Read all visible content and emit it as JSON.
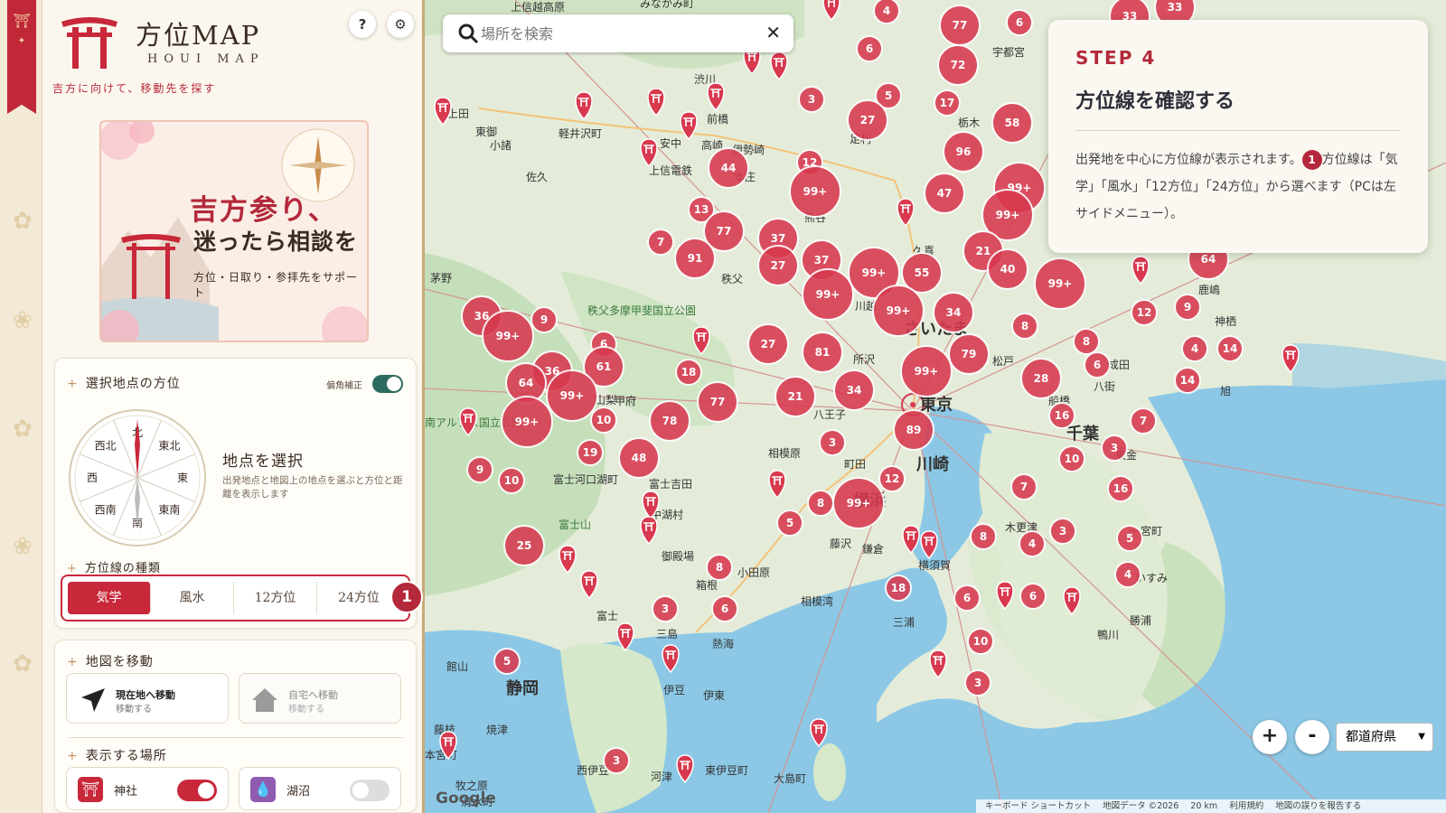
{
  "app": {
    "title": "方位MAP",
    "subtitle": "HOUI MAP",
    "tagline": "吉方に向けて、移動先を探す",
    "help_icon": "?",
    "settings_icon": "⚙"
  },
  "banner": {
    "line1": "吉方参り、",
    "line2": "迷ったら相談を",
    "line3": "方位・日取り・参拝先をサポート"
  },
  "direction_section": {
    "heading": "選択地点の方位",
    "toggle_label": "偏角補正",
    "toggle_on": true,
    "compass_labels": [
      "北",
      "東北",
      "東",
      "東南",
      "南",
      "西南",
      "西",
      "西北"
    ],
    "point_title": "地点を選択",
    "point_desc": "出発地点と地図上の地点を選ぶと方位と距離を表示します"
  },
  "line_types": {
    "heading": "方位線の種類",
    "options": [
      "気学",
      "風水",
      "12方位",
      "24方位"
    ],
    "selected": "気学",
    "step_badge": "1"
  },
  "move_section": {
    "heading": "地図を移動",
    "current": {
      "label": "現在地へ移動",
      "sub": "移動する"
    },
    "home": {
      "label": "自宅へ移動",
      "sub": "移動する"
    }
  },
  "places_section": {
    "heading": "表示する場所",
    "items": [
      {
        "label": "神社",
        "on": true,
        "icon": "torii-icon",
        "color": "#c8283a"
      },
      {
        "label": "湖沼",
        "on": false,
        "icon": "water-drop-icon",
        "color": "#8e5bb0"
      }
    ]
  },
  "search": {
    "placeholder": "場所を検索",
    "value": ""
  },
  "step_panel": {
    "step": "STEP 4",
    "title": "方位線を確認する",
    "body_before": "出発地を中心に方位線が表示されます。",
    "badge": "1",
    "body_after": "方位線は「気学」「風水」「12方位」「24方位」から選べます（PCは左サイドメニュー）。"
  },
  "map_controls": {
    "zoom_in": "+",
    "zoom_out": "-",
    "region_select": "都道府県"
  },
  "attribution": {
    "google": "Google",
    "shortcuts": "キーボード ショートカット",
    "data": "地図データ ©2026",
    "scale": "20 km",
    "terms": "利用規約",
    "report": "地図の誤りを報告する"
  },
  "map": {
    "places": [
      {
        "name": "上信越高原"
      },
      {
        "name": "みなかみ町"
      },
      {
        "name": "渋川"
      },
      {
        "name": "宇都宮"
      },
      {
        "name": "上田"
      },
      {
        "name": "軽井沢町"
      },
      {
        "name": "前橋"
      },
      {
        "name": "高崎"
      },
      {
        "name": "東御"
      },
      {
        "name": "小諸"
      },
      {
        "name": "安中"
      },
      {
        "name": "伊勢崎"
      },
      {
        "name": "足利"
      },
      {
        "name": "本庄"
      },
      {
        "name": "佐久"
      },
      {
        "name": "上信電鉄"
      },
      {
        "name": "栃木"
      },
      {
        "name": "熊谷"
      },
      {
        "name": "久喜"
      },
      {
        "name": "茅野"
      },
      {
        "name": "秩父"
      },
      {
        "name": "川越"
      },
      {
        "name": "さいたま"
      },
      {
        "name": "所沢"
      },
      {
        "name": "秩父多摩甲斐国立公園"
      },
      {
        "name": "甲府"
      },
      {
        "name": "山梨"
      },
      {
        "name": "八王子"
      },
      {
        "name": "東京"
      },
      {
        "name": "松戸"
      },
      {
        "name": "船橋"
      },
      {
        "name": "八街"
      },
      {
        "name": "成田"
      },
      {
        "name": "鹿嶋"
      },
      {
        "name": "神栖"
      },
      {
        "name": "旭"
      },
      {
        "name": "南アルプス国立公園"
      },
      {
        "name": "相模原"
      },
      {
        "name": "町田"
      },
      {
        "name": "川崎"
      },
      {
        "name": "千葉"
      },
      {
        "name": "東金"
      },
      {
        "name": "富士河口湖町"
      },
      {
        "name": "富士吉田"
      },
      {
        "name": "中湖村"
      },
      {
        "name": "富士山"
      },
      {
        "name": "横浜"
      },
      {
        "name": "木更津"
      },
      {
        "name": "藤沢"
      },
      {
        "name": "鎌倉"
      },
      {
        "name": "横須賀"
      },
      {
        "name": "小田原"
      },
      {
        "name": "御殿場"
      },
      {
        "name": "箱根"
      },
      {
        "name": "一宮町"
      },
      {
        "name": "いすみ"
      },
      {
        "name": "富士"
      },
      {
        "name": "三島"
      },
      {
        "name": "熱海"
      },
      {
        "name": "三浦"
      },
      {
        "name": "勝浦"
      },
      {
        "name": "鴨川"
      },
      {
        "name": "静岡"
      },
      {
        "name": "伊豆"
      },
      {
        "name": "伊東"
      },
      {
        "name": "相模湾"
      },
      {
        "name": "館山"
      },
      {
        "name": "焼津"
      },
      {
        "name": "藤枝"
      },
      {
        "name": "西伊豆"
      },
      {
        "name": "河津"
      },
      {
        "name": "東伊豆町"
      },
      {
        "name": "大島町"
      },
      {
        "name": "牧之原"
      },
      {
        "name": "本宮町"
      },
      {
        "name": "清水町"
      }
    ],
    "clusters": [
      {
        "label": "4"
      },
      {
        "label": "77"
      },
      {
        "label": "6"
      },
      {
        "label": "33"
      },
      {
        "label": "33"
      },
      {
        "label": "72"
      },
      {
        "label": "6"
      },
      {
        "label": "3"
      },
      {
        "label": "5"
      },
      {
        "label": "17"
      },
      {
        "label": "27"
      },
      {
        "label": "58"
      },
      {
        "label": "96"
      },
      {
        "label": "44"
      },
      {
        "label": "12"
      },
      {
        "label": "99+"
      },
      {
        "label": "99+"
      },
      {
        "label": "47"
      },
      {
        "label": "99+"
      },
      {
        "label": "13"
      },
      {
        "label": "77"
      },
      {
        "label": "7"
      },
      {
        "label": "91"
      },
      {
        "label": "37"
      },
      {
        "label": "27"
      },
      {
        "label": "37"
      },
      {
        "label": "99+"
      },
      {
        "label": "55"
      },
      {
        "label": "21"
      },
      {
        "label": "40"
      },
      {
        "label": "99+"
      },
      {
        "label": "64"
      },
      {
        "label": "99+"
      },
      {
        "label": "99+"
      },
      {
        "label": "34"
      },
      {
        "label": "12"
      },
      {
        "label": "9"
      },
      {
        "label": "36"
      },
      {
        "label": "99+"
      },
      {
        "label": "9"
      },
      {
        "label": "8"
      },
      {
        "label": "6"
      },
      {
        "label": "27"
      },
      {
        "label": "81"
      },
      {
        "label": "79"
      },
      {
        "label": "8"
      },
      {
        "label": "4"
      },
      {
        "label": "14"
      },
      {
        "label": "61"
      },
      {
        "label": "36"
      },
      {
        "label": "18"
      },
      {
        "label": "99+"
      },
      {
        "label": "6"
      },
      {
        "label": "64"
      },
      {
        "label": "99+"
      },
      {
        "label": "34"
      },
      {
        "label": "77"
      },
      {
        "label": "21"
      },
      {
        "label": "28"
      },
      {
        "label": "14"
      },
      {
        "label": "10"
      },
      {
        "label": "78"
      },
      {
        "label": "99+"
      },
      {
        "label": "89"
      },
      {
        "label": "16"
      },
      {
        "label": "7"
      },
      {
        "label": "19"
      },
      {
        "label": "48"
      },
      {
        "label": "3"
      },
      {
        "label": "3"
      },
      {
        "label": "9"
      },
      {
        "label": "10"
      },
      {
        "label": "12"
      },
      {
        "label": "10"
      },
      {
        "label": "7"
      },
      {
        "label": "16"
      },
      {
        "label": "8"
      },
      {
        "label": "99+"
      },
      {
        "label": "5"
      },
      {
        "label": "3"
      },
      {
        "label": "5"
      },
      {
        "label": "25"
      },
      {
        "label": "8"
      },
      {
        "label": "8"
      },
      {
        "label": "4"
      },
      {
        "label": "4"
      },
      {
        "label": "6"
      },
      {
        "label": "18"
      },
      {
        "label": "6"
      },
      {
        "label": "3"
      },
      {
        "label": "6"
      },
      {
        "label": "10"
      },
      {
        "label": "5"
      },
      {
        "label": "3"
      },
      {
        "label": "3"
      }
    ]
  }
}
